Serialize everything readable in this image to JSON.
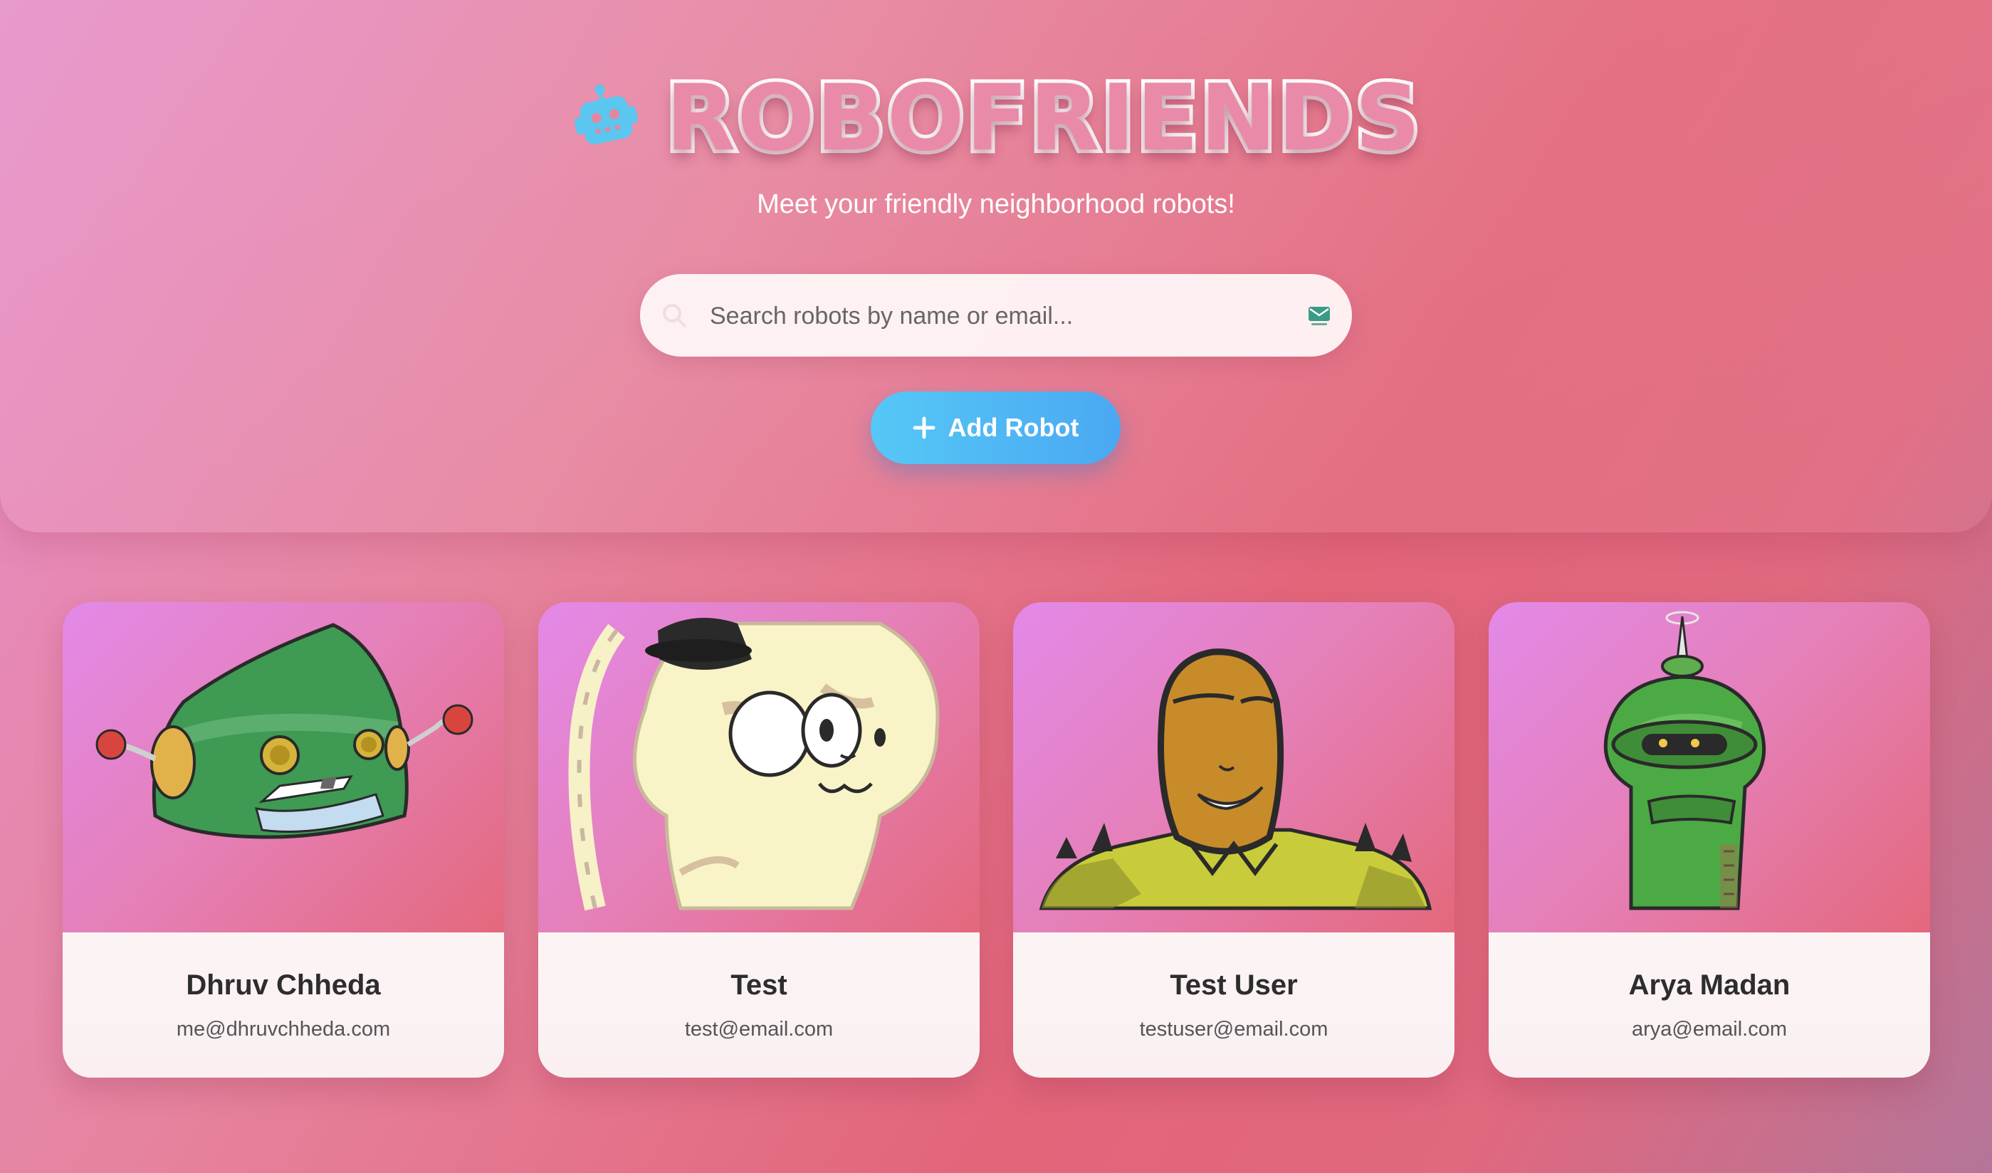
{
  "header": {
    "logo_icon": "robot-icon",
    "title": "ROBOFRIENDS",
    "subtitle": "Meet your friendly neighborhood robots!",
    "search": {
      "placeholder": "Search robots by name or email...",
      "value": "",
      "icon": "search-icon",
      "trailing_icon": "mail-icon"
    },
    "add_button": {
      "icon": "plus-icon",
      "label": "Add Robot"
    }
  },
  "robots": [
    {
      "name": "Dhruv Chheda",
      "email": "me@dhruvchheda.com"
    },
    {
      "name": "Test",
      "email": "test@email.com"
    },
    {
      "name": "Test User",
      "email": "testuser@email.com"
    },
    {
      "name": "Arya Madan",
      "email": "arya@email.com"
    }
  ],
  "colors": {
    "accent": "#4fb8f4",
    "logo": "#5bc6f0",
    "text_dark": "#2d2d2d",
    "text_muted": "#555555"
  }
}
